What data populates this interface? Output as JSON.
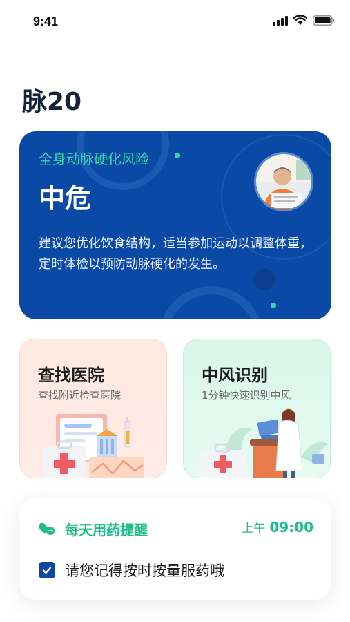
{
  "status_bar": {
    "time": "9:41",
    "icons": [
      "signal-icon",
      "wifi-icon",
      "battery-icon"
    ]
  },
  "app": {
    "title": "脉20"
  },
  "risk_card": {
    "label": "全身动脉硬化风险",
    "level": "中危",
    "advice": "建议您优化饮食结构，适当参加运动以调整体重，定时体检以预防动脉硬化的发生。",
    "colors": {
      "background": "#0a4aa6",
      "accent": "#34d8a8"
    }
  },
  "features": [
    {
      "title": "查找医院",
      "subtitle": "查找附近检查医院",
      "icon": "hospital-illustration"
    },
    {
      "title": "中风识别",
      "subtitle": "1分钟快速识别中风",
      "icon": "doctor-illustration"
    }
  ],
  "reminder": {
    "title": "每天用药提醒",
    "ampm": "上午",
    "time": "09:00",
    "checked": true,
    "note": "请您记得按时按量服药哦",
    "color": "#1bbf8a"
  }
}
